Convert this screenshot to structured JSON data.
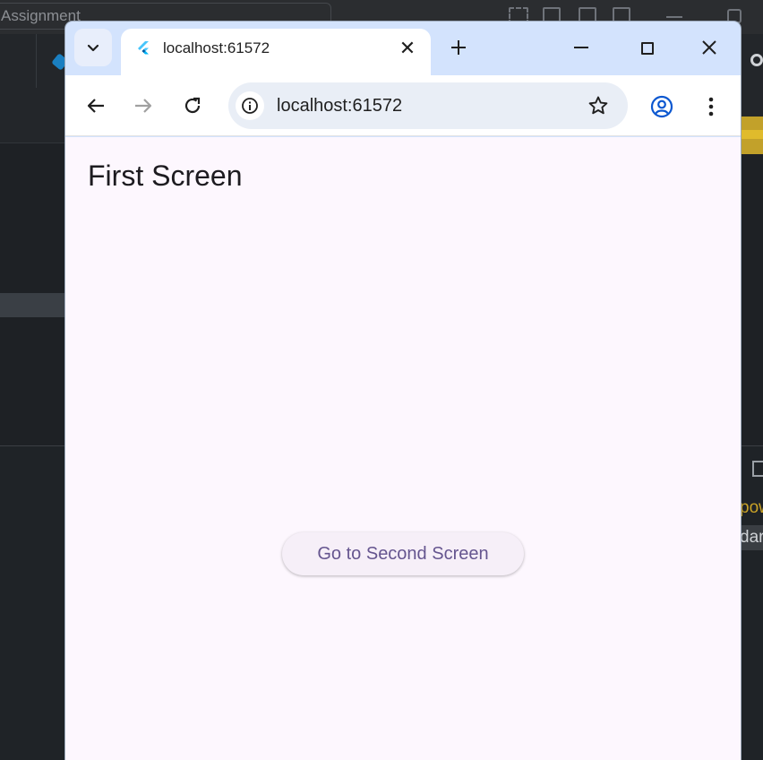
{
  "ide": {
    "search_text": "Assignment",
    "peek_text_1": "pow",
    "peek_text_2": "dar"
  },
  "browser": {
    "tab": {
      "favicon": "flutter-logo",
      "title": "localhost:61572",
      "close_icon": "close-icon"
    },
    "new_tab_icon": "plus-icon",
    "window_controls": [
      "minimize-icon",
      "maximize-icon",
      "close-icon"
    ],
    "toolbar": {
      "back_icon": "arrow-left-icon",
      "forward_icon": "arrow-right-icon",
      "reload_icon": "reload-icon",
      "site_info_icon": "info-icon",
      "url": "localhost:61572",
      "bookmark_icon": "star-icon",
      "profile_icon": "profile-icon",
      "menu_icon": "more-vertical-icon"
    }
  },
  "app": {
    "title": "First Screen",
    "button_label": "Go to Second Screen"
  },
  "colors": {
    "browser_frame": "#d3e3fd",
    "page_background": "#fdf7fe",
    "button_text": "#65558f",
    "profile_accent": "#0b57d0"
  }
}
